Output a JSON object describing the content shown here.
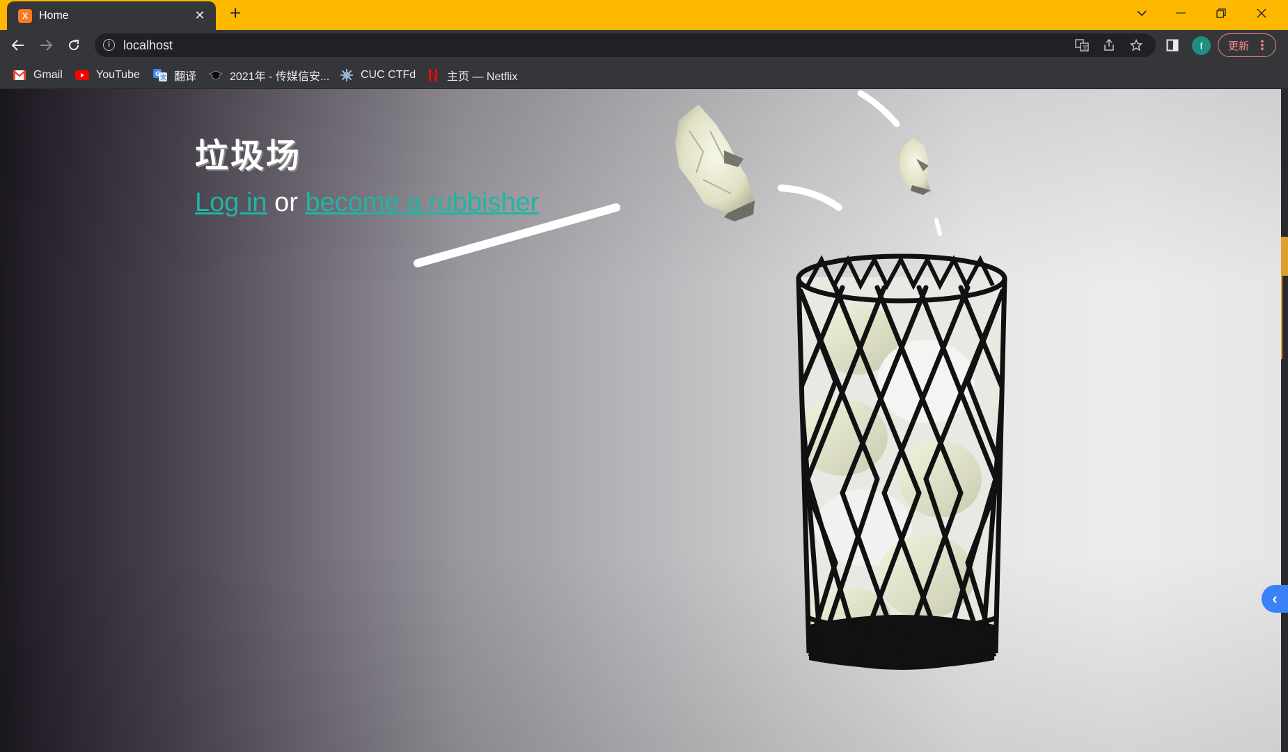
{
  "browser": {
    "tab": {
      "title": "Home",
      "favicon": "xampp-favicon",
      "favicon_text": "X"
    },
    "new_tab_label": "+",
    "window_controls": [
      "chevron-down-icon",
      "minimize-icon",
      "restore-icon",
      "close-icon"
    ],
    "address": "localhost",
    "update_label": "更新",
    "profile_initial": "f",
    "bookmarks": [
      {
        "label": "Gmail",
        "icon": "gmail-icon"
      },
      {
        "label": "YouTube",
        "icon": "youtube-icon"
      },
      {
        "label": "翻译",
        "icon": "google-translate-icon"
      },
      {
        "label": "2021年 - 传媒信安...",
        "icon": "graduation-cap-icon"
      },
      {
        "label": "CUC CTFd",
        "icon": "ctfd-icon"
      },
      {
        "label": "主页 — Netflix",
        "icon": "netflix-icon"
      }
    ]
  },
  "page": {
    "heading": "垃圾场",
    "login_link": "Log in",
    "or_text": "or",
    "register_link": "become a rubbisher"
  },
  "colors": {
    "tab_strip": "#ffb800",
    "chrome_dark": "#35363a",
    "link": "#1fb5a5",
    "update_accent": "#f28b82",
    "avatar": "#1e8e7e"
  }
}
